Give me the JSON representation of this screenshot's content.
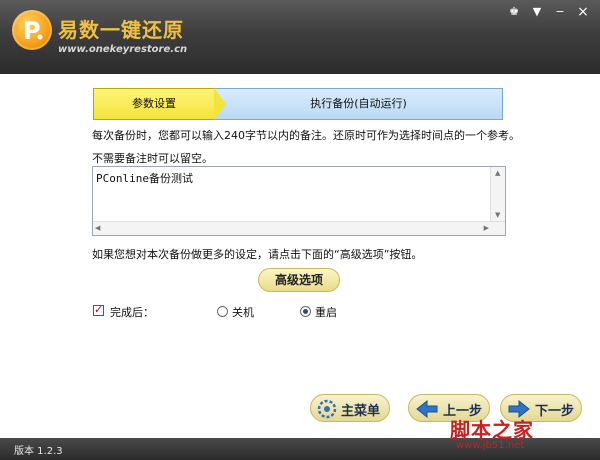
{
  "app": {
    "title": "易数一键还原",
    "url": "www.onekeyrestore.cn"
  },
  "window_controls": {
    "skin": "♚",
    "menu": "▼",
    "minimize": "−",
    "close": "×"
  },
  "steps": [
    {
      "label": "参数设置",
      "active": true
    },
    {
      "label": "执行备份(自动运行)",
      "active": false
    }
  ],
  "note": {
    "instruction": "每次备份时，您都可以输入240字节以内的备注。还原时可作为选择时间点的一个参考。",
    "optional_hint": "不需要备注时可以留空。",
    "value": "PConline备份测试"
  },
  "advanced": {
    "hint": "如果您想对本次备份做更多的设定，请点击下面的“高级选项”按钮。",
    "button_label": "高级选项"
  },
  "after_completion": {
    "label": "完成后：",
    "checked": true,
    "options": [
      {
        "label": "关机",
        "selected": false
      },
      {
        "label": "重启",
        "selected": true
      }
    ]
  },
  "nav": {
    "main_menu": "主菜单",
    "prev": "上一步",
    "next": "下一步"
  },
  "footer": {
    "version": "版本 1.2.3"
  },
  "watermark": {
    "text": "脚本之家",
    "url": "www.jb51.net"
  },
  "colors": {
    "title_gold": "#f0c040",
    "step_active": "#f3e43a",
    "step_inactive": "#bad9f3",
    "watermark_red": "#c92020"
  }
}
